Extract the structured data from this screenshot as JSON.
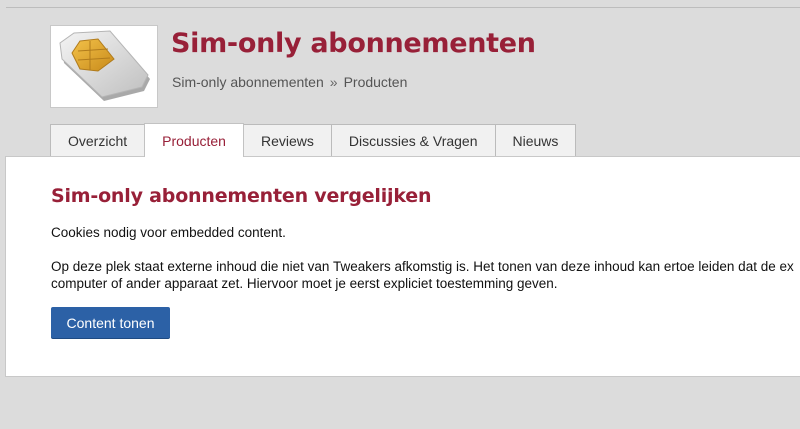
{
  "header": {
    "title": "Sim-only abonnementen",
    "breadcrumb": [
      "Sim-only abonnementen",
      "Producten"
    ],
    "breadcrumb_separator": "»",
    "thumbnail_icon": "sim-card-icon"
  },
  "tabs": [
    {
      "label": "Overzicht",
      "active": false
    },
    {
      "label": "Producten",
      "active": true
    },
    {
      "label": "Reviews",
      "active": false
    },
    {
      "label": "Discussies & Vragen",
      "active": false
    },
    {
      "label": "Nieuws",
      "active": false
    }
  ],
  "content": {
    "heading": "Sim-only abonnementen vergelijken",
    "notice": "Cookies nodig voor embedded content.",
    "body_line1": "Op deze plek staat externe inhoud die niet van Tweakers afkomstig is. Het tonen van deze inhoud kan ertoe leiden dat de ex",
    "body_line2": "computer of ander apparaat zet. Hiervoor moet je eerst expliciet toestemming geven.",
    "button_label": "Content tonen"
  },
  "colors": {
    "accent": "#982038",
    "button": "#2c61a6",
    "background": "#dcdcdc"
  }
}
